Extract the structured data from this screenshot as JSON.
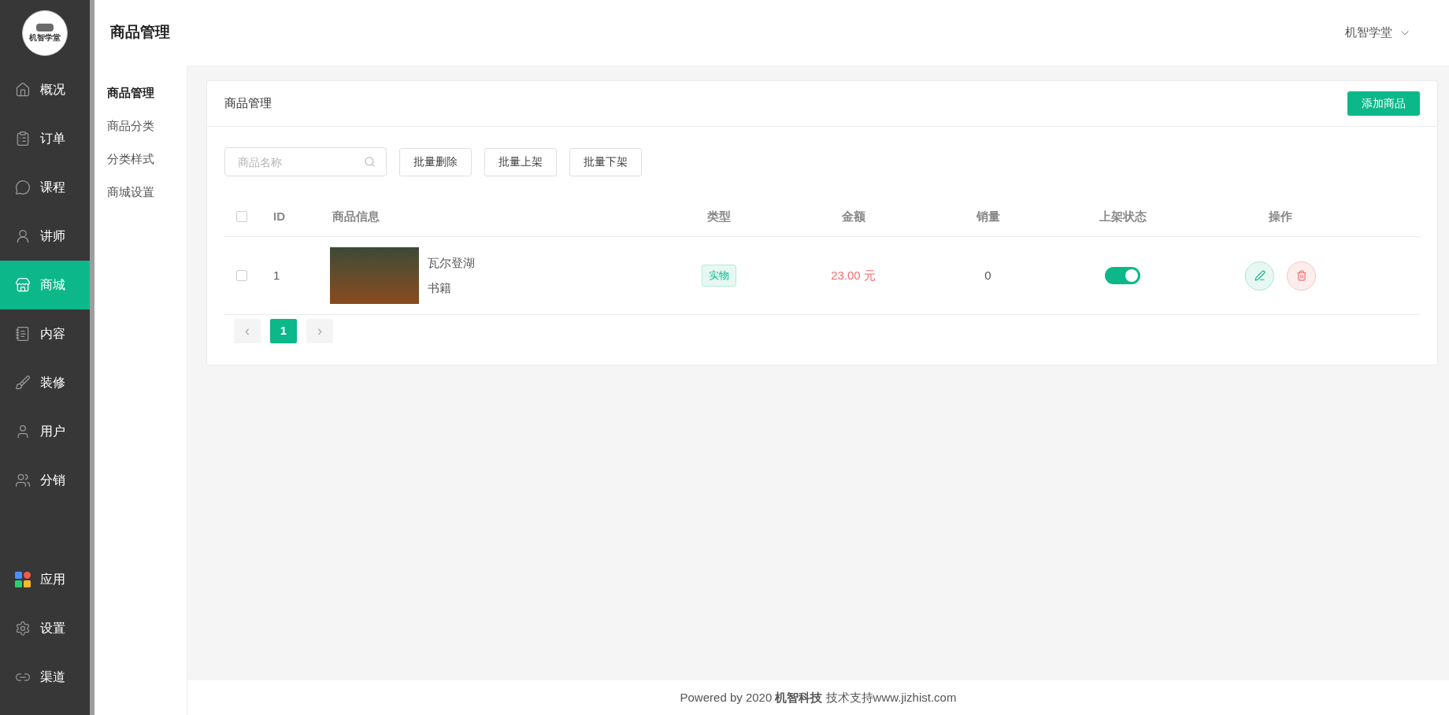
{
  "sidebar": {
    "logo_text": "机智学堂",
    "main_items": [
      {
        "label": "概况",
        "selected": false
      },
      {
        "label": "订单",
        "selected": false
      },
      {
        "label": "课程",
        "selected": false
      },
      {
        "label": "讲师",
        "selected": false
      },
      {
        "label": "商城",
        "selected": true
      },
      {
        "label": "内容",
        "selected": false
      },
      {
        "label": "装修",
        "selected": false
      },
      {
        "label": "用户",
        "selected": false
      },
      {
        "label": "分销",
        "selected": false
      }
    ],
    "bottom_items": [
      {
        "label": "应用",
        "selected": false
      },
      {
        "label": "设置",
        "selected": false
      },
      {
        "label": "渠道",
        "selected": false
      }
    ]
  },
  "header": {
    "title": "商品管理",
    "account": "机智学堂"
  },
  "subnav": [
    {
      "label": "商品管理",
      "selected": true
    },
    {
      "label": "商品分类",
      "selected": false
    },
    {
      "label": "分类样式",
      "selected": false
    },
    {
      "label": "商城设置",
      "selected": false
    }
  ],
  "card": {
    "title": "商品管理",
    "add_button": "添加商品",
    "search": {
      "placeholder": "商品名称"
    },
    "batch_buttons": [
      "批量删除",
      "批量上架",
      "批量下架"
    ],
    "table": {
      "columns": [
        "ID",
        "商品信息",
        "类型",
        "金额",
        "销量",
        "上架状态",
        "操作"
      ],
      "header_checked": false,
      "rows": [
        {
          "checked": false,
          "id": "1",
          "name": "瓦尔登湖",
          "category": "书籍",
          "type": "实物",
          "price": "23.00 元",
          "sales": "0",
          "on": true
        }
      ]
    },
    "pagination": {
      "prev": "‹",
      "next": "›",
      "pages": [
        {
          "label": "1",
          "selected": true
        }
      ]
    }
  },
  "footer": "Powered by 2020 **机智科技** 技术支持www.jizhist.com"
}
